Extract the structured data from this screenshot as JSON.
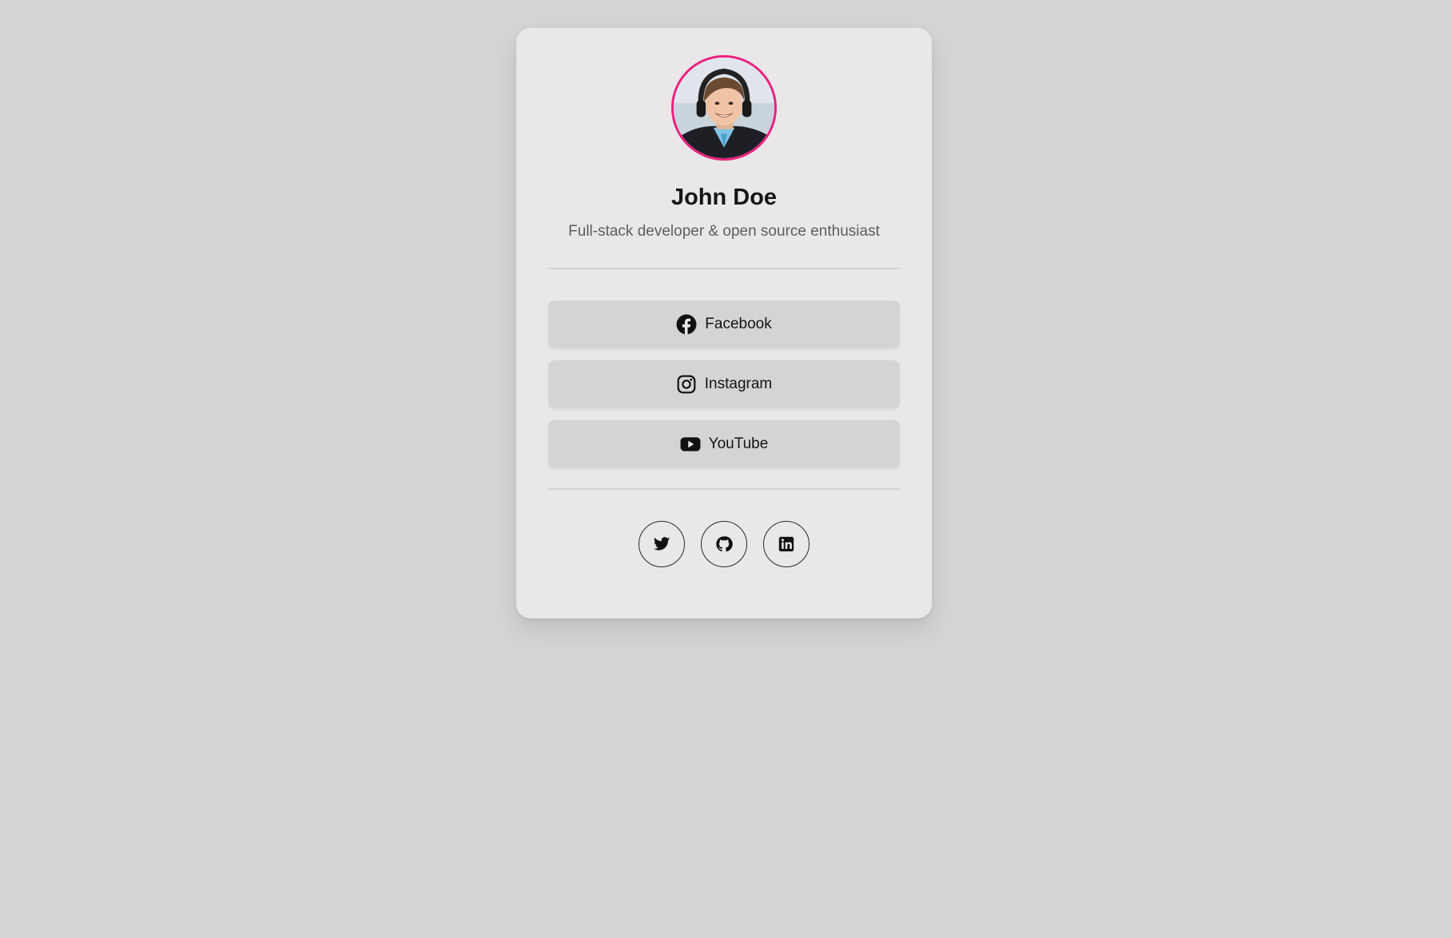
{
  "profile": {
    "name": "John Doe",
    "bio": "Full-stack developer & open source enthusiast",
    "avatar_ring_color": "#ee1f7f"
  },
  "links": [
    {
      "label": "Facebook",
      "icon": "facebook-icon"
    },
    {
      "label": "Instagram",
      "icon": "instagram-icon"
    },
    {
      "label": "YouTube",
      "icon": "youtube-icon"
    }
  ],
  "socials": [
    {
      "icon": "twitter-icon"
    },
    {
      "icon": "github-icon"
    },
    {
      "icon": "linkedin-icon"
    }
  ],
  "colors": {
    "page_background": "#d5d3d4",
    "card_background": "#e9e7e8",
    "button_background": "#d5d3d4",
    "text": "#161616",
    "muted_text": "#5f5d5e"
  }
}
